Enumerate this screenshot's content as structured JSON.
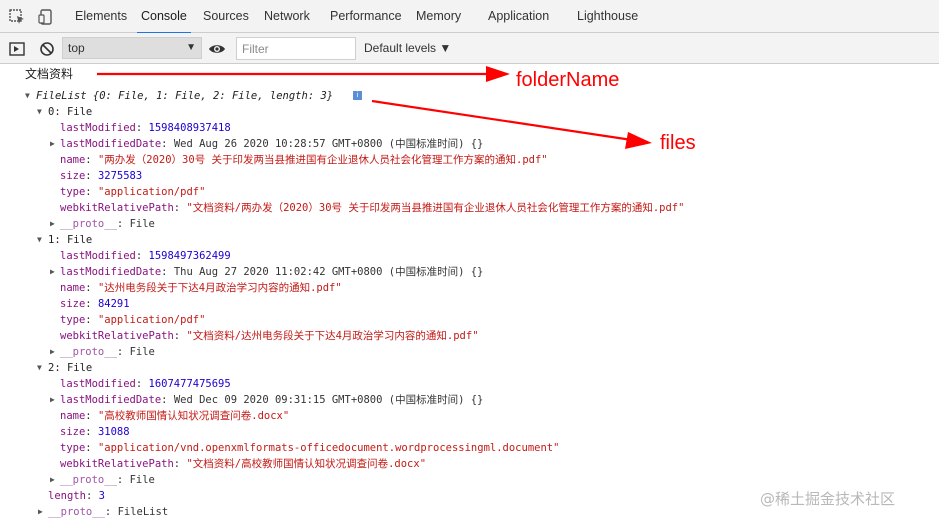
{
  "tabs": [
    {
      "label": "Elements",
      "active": false
    },
    {
      "label": "Console",
      "active": true
    },
    {
      "label": "Sources",
      "active": false
    },
    {
      "label": "Network",
      "active": false
    },
    {
      "label": "Performance",
      "active": false
    },
    {
      "label": "Memory",
      "active": false
    },
    {
      "label": "Application",
      "active": false
    },
    {
      "label": "Lighthouse",
      "active": false
    }
  ],
  "toolbar": {
    "context": "top",
    "filter_placeholder": "Filter",
    "levels_label": "Default levels ▼"
  },
  "console": {
    "log_line": "文档资料",
    "filelist_summary": "FileList {0: File, 1: File, 2: File, length: 3}",
    "info_badge": "i",
    "files": [
      {
        "index_label": "0: File",
        "lastModified": "1598408937418",
        "lastModifiedDate": "Wed Aug 26 2020 10:28:57 GMT+0800 (中国标准时间) {}",
        "name": "\"两办发（2020）30号  关于印发两当县推进国有企业退休人员社会化管理工作方案的通知.pdf\"",
        "size": "3275583",
        "type": "\"application/pdf\"",
        "webkitRelativePath": "\"文档资料/两办发（2020）30号  关于印发两当县推进国有企业退休人员社会化管理工作方案的通知.pdf\"",
        "proto": "File"
      },
      {
        "index_label": "1: File",
        "lastModified": "1598497362499",
        "lastModifiedDate": "Thu Aug 27 2020 11:02:42 GMT+0800 (中国标准时间) {}",
        "name": "\"达州电务段关于下达4月政治学习内容的通知.pdf\"",
        "size": "84291",
        "type": "\"application/pdf\"",
        "webkitRelativePath": "\"文档资料/达州电务段关于下达4月政治学习内容的通知.pdf\"",
        "proto": "File"
      },
      {
        "index_label": "2: File",
        "lastModified": "1607477475695",
        "lastModifiedDate": "Wed Dec 09 2020 09:31:15 GMT+0800 (中国标准时间) {}",
        "name": "\"高校教师国情认知状况调查问卷.docx\"",
        "size": "31088",
        "type": "\"application/vnd.openxmlformats-officedocument.wordprocessingml.document\"",
        "webkitRelativePath": "\"文档资料/高校教师国情认知状况调查问卷.docx\"",
        "proto": "File"
      }
    ],
    "keys": {
      "lastModified": "lastModified",
      "lastModifiedDate": "lastModifiedDate",
      "name": "name",
      "size": "size",
      "type": "type",
      "webkitRelativePath": "webkitRelativePath",
      "proto": "__proto__"
    },
    "length_label": "length",
    "length_value": "3",
    "list_proto_label": "__proto__",
    "list_proto_value": "FileList"
  },
  "annotations": {
    "folder": "folderName",
    "files": "files",
    "color": "#ff0000"
  },
  "watermark": "@稀土掘金技术社区"
}
